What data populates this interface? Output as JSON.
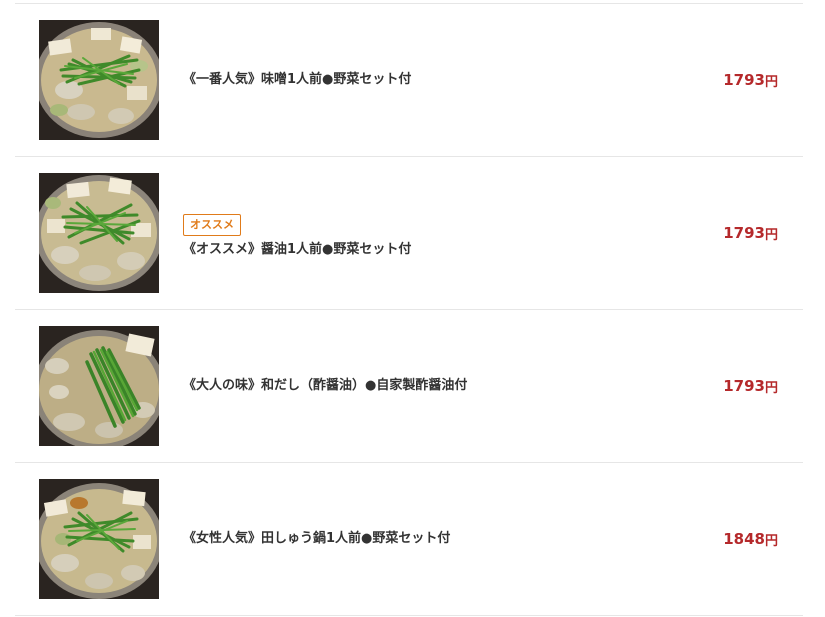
{
  "menu": {
    "items": [
      {
        "name": "《一番人気》味噌1人前●野菜セット付",
        "badge": "",
        "price": "1793",
        "currency": "円",
        "image": "motsunabe-miso-photo"
      },
      {
        "name": "《オススメ》醤油1人前●野菜セット付",
        "badge": "オススメ",
        "price": "1793",
        "currency": "円",
        "image": "motsunabe-shoyu-photo"
      },
      {
        "name": "《大人の味》和だし（酢醤油）●自家製酢醤油付",
        "badge": "",
        "price": "1793",
        "currency": "円",
        "image": "motsunabe-wadashi-photo"
      },
      {
        "name": "《女性人気》田しゅう鍋1人前●野菜セット付",
        "badge": "",
        "price": "1848",
        "currency": "円",
        "image": "motsunabe-tashuu-photo"
      }
    ]
  },
  "colors": {
    "price": "#b5292b",
    "badge": "#e07b1a",
    "divider": "#e6e6e6",
    "text": "#333333"
  }
}
